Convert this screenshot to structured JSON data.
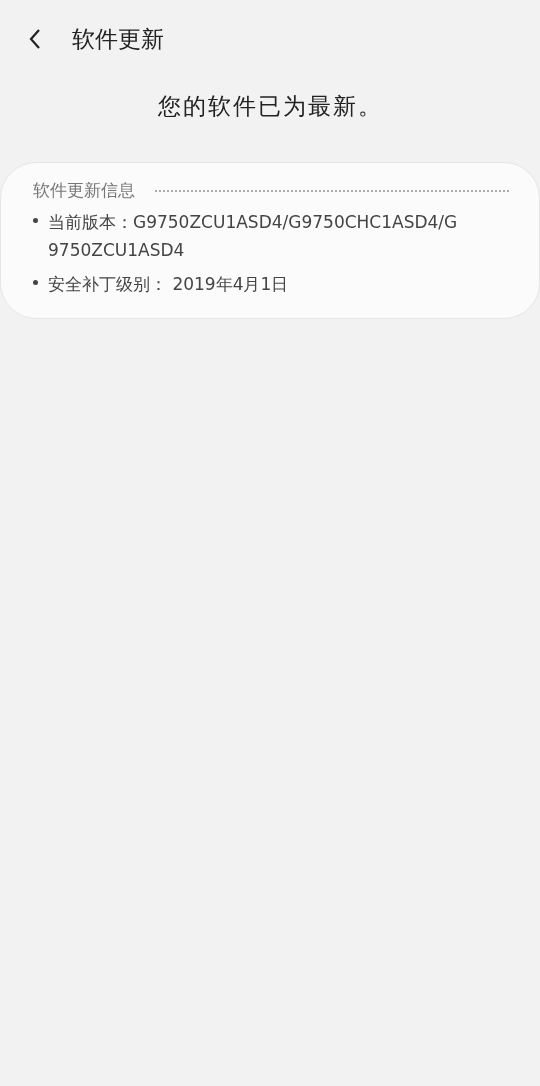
{
  "header": {
    "title": "软件更新"
  },
  "message": "您的软件已为最新。",
  "info_card": {
    "title": "软件更新信息",
    "items": [
      "当前版本：G9750ZCU1ASD4/G9750CHC1ASD4/G9750ZCU1ASD4",
      "安全补丁级别： 2019年4月1日"
    ]
  }
}
